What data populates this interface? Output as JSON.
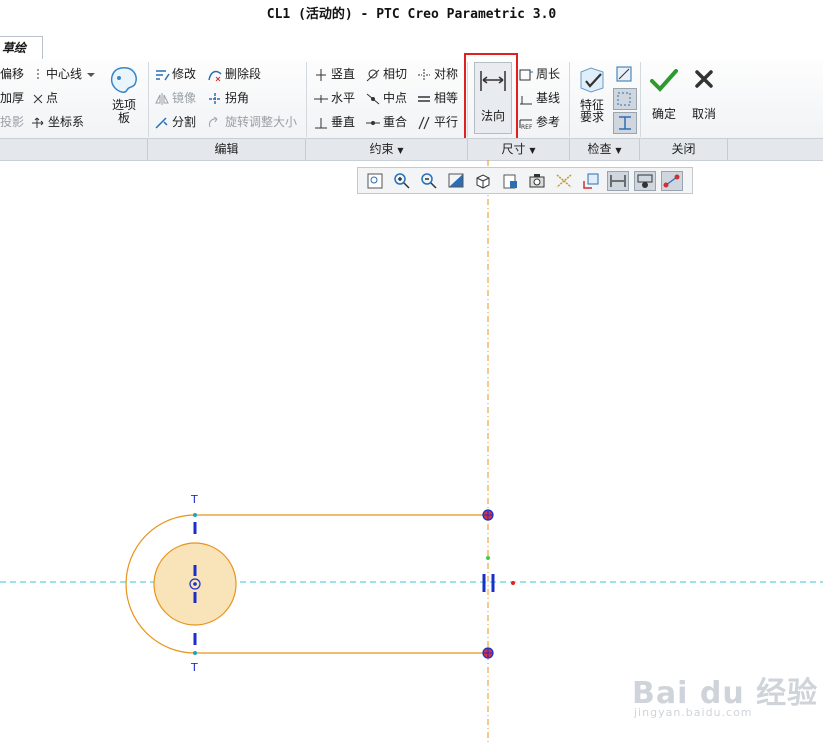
{
  "window": {
    "title": "CL1 (活动的) - PTC Creo Parametric 3.0"
  },
  "tabs": [
    {
      "label": "草绘"
    }
  ],
  "ribbon": {
    "left": {
      "offset": "偏移",
      "thicken": "加厚",
      "project": "投影",
      "centerline": "中心线",
      "point": "点",
      "coordsys": "坐标系",
      "palette": "选项板"
    },
    "edit": {
      "modify": "修改",
      "delete_segment": "删除段",
      "mirror": "镜像",
      "corner": "拐角",
      "divide": "分割",
      "rotate_resize": "旋转调整大小"
    },
    "constrain": {
      "vertical": "竖直",
      "horizontal": "水平",
      "perpendicular": "垂直",
      "tangent": "相切",
      "midpoint": "中点",
      "coincident": "重合",
      "symmetric": "对称",
      "equal": "相等",
      "parallel": "平行"
    },
    "dimension": {
      "normal": "法向",
      "perimeter": "周长",
      "baseline": "基线",
      "reference": "参考"
    },
    "inspect": {
      "feature_requirements": "特征要求"
    },
    "close": {
      "ok": "确定",
      "cancel": "取消"
    }
  },
  "groups": {
    "edit": "编辑",
    "constrain": "约束",
    "dimension": "尺寸",
    "inspect": "检查",
    "close": "关闭"
  },
  "colors": {
    "accent_red": "#e02020",
    "sketch": "#e8941a",
    "axis": "#38c4d8",
    "fill": "#f8e4b8",
    "constraint": "#1a2fc8",
    "ok": "#2e9a2e"
  },
  "sketch": {
    "top_label": "T",
    "bottom_label": "T"
  },
  "watermark": {
    "brand": "Bai du 经验",
    "url": "jingyan.baidu.com"
  }
}
